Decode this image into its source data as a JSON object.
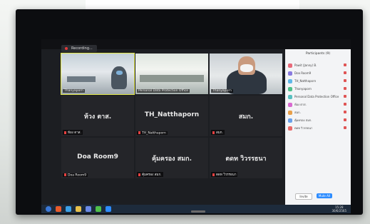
{
  "recording_label": "Recording...",
  "panel": {
    "title": "Participants (9)",
    "participants": [
      {
        "name": "Pawit (Janny) B.",
        "color": "#e86a7a"
      },
      {
        "name": "Doa Room9",
        "color": "#8a7be0"
      },
      {
        "name": "TH_Natthaporn",
        "color": "#5fb8e8"
      },
      {
        "name": "Thanyaporn",
        "color": "#4fc08a"
      },
      {
        "name": "Personal Data Protection Office",
        "color": "#58c0c0"
      },
      {
        "name": "ห้อง ตาส.",
        "color": "#d86ad0"
      },
      {
        "name": "สมก.",
        "color": "#e8a04a"
      },
      {
        "name": "คุ้มครอง สมก.",
        "color": "#6aa0e8"
      },
      {
        "name": "ตดท วิวรรธนา",
        "color": "#e86a6a"
      }
    ],
    "invite_label": "Invite",
    "mute_label": "Mute All"
  },
  "tiles": [
    {
      "label": "Thanyaporn",
      "name": ""
    },
    {
      "label": "Personal Data Protection Office",
      "name": ""
    },
    {
      "label": "Thanyaporn",
      "name": ""
    },
    {
      "label": "ห้อง ตาส.",
      "name": "ห้วง ตาส."
    },
    {
      "label": "TH_Natthaporn",
      "name": "TH_Natthaporn"
    },
    {
      "label": "สมก.",
      "name": "สมก."
    },
    {
      "label": "Doa Room9",
      "name": "Doa Room9"
    },
    {
      "label": "คุ้มครอง สมก.",
      "name": "คุ้มครอง สมก."
    },
    {
      "label": "ตดท วิวรรธนา",
      "name": "ตดท วิวรรธนา"
    }
  ],
  "clock": {
    "time": "15:28",
    "date": "30/6/2565"
  }
}
